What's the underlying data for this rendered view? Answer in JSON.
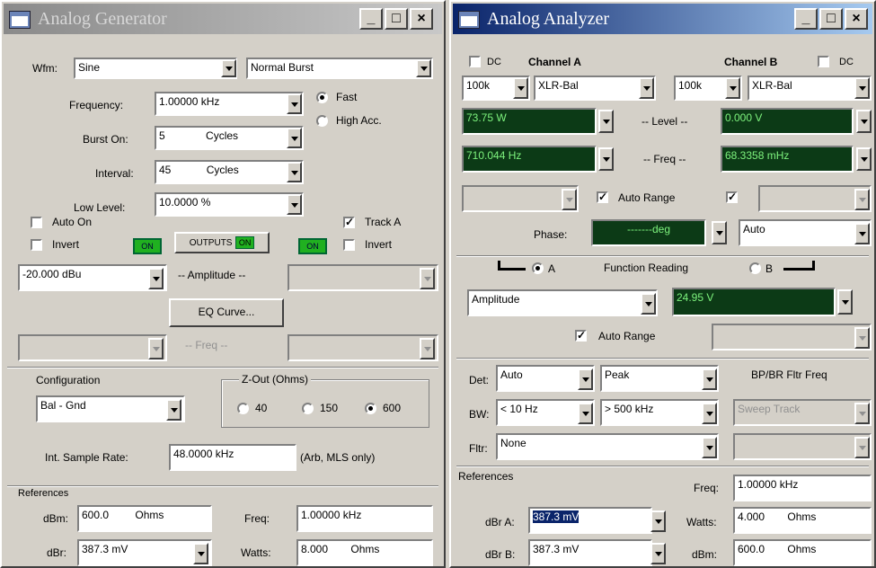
{
  "generator": {
    "title": "Analog Generator",
    "wfm_label": "Wfm:",
    "wfm_value": "Sine",
    "burst_mode": "Normal Burst",
    "frequency_label": "Frequency:",
    "frequency_value": "1.00000 kHz",
    "fast_label": "Fast",
    "high_acc_label": "High Acc.",
    "burst_on_label": "Burst On:",
    "burst_on_value": "5",
    "burst_on_unit": "Cycles",
    "interval_label": "Interval:",
    "interval_value": "45",
    "interval_unit": "Cycles",
    "low_level_label": "Low Level:",
    "low_level_value": "10.0000  %",
    "auto_on_label": "Auto On",
    "track_a_label": "Track A",
    "invert_left_label": "Invert",
    "invert_right_label": "Invert",
    "outputs_label": "OUTPUTS",
    "led_on": "ON",
    "amplitude_value": "-20.000  dBu",
    "amplitude_label": "-- Amplitude --",
    "eq_curve_button": "EQ Curve...",
    "frequency_mid_label": "-- Freq --",
    "configuration_label": "Configuration",
    "configuration_value": "Bal - Gnd",
    "zout_label": "Z-Out (Ohms)",
    "zout_40": "40",
    "zout_150": "150",
    "zout_600": "600",
    "sample_rate_label": "Int. Sample Rate:",
    "sample_rate_value": "48.0000 kHz",
    "sample_rate_note": "(Arb, MLS only)",
    "references_label": "References",
    "dbm_label": "dBm:",
    "dbm_value": "600.0",
    "dbm_unit": "Ohms",
    "freq_ref_label": "Freq:",
    "freq_ref_value": "1.00000 kHz",
    "dbr_label": "dBr:",
    "dbr_value": "387.3  mV",
    "watts_label": "Watts:",
    "watts_value": "8.000",
    "watts_unit": "Ohms"
  },
  "analyzer": {
    "title": "Analog Analyzer",
    "dc_a_label": "DC",
    "channel_a_label": "Channel A",
    "channel_b_label": "Channel B",
    "dc_b_label": "DC",
    "range_a": "100k",
    "input_a": "XLR-Bal",
    "range_b": "100k",
    "input_b": "XLR-Bal",
    "level_a": "73.75  W",
    "level_label": "-- Level --",
    "level_b": "0.000  V",
    "freq_a": "710.044 Hz",
    "freq_label": "-- Freq --",
    "freq_b": "68.3358 mHz",
    "auto_range_label": "Auto Range",
    "phase_label": "Phase:",
    "phase_value": "-------deg",
    "phase_mode": "Auto",
    "radio_a_label": "A",
    "function_reading_label": "Function Reading",
    "radio_b_label": "B",
    "function_value": "Amplitude",
    "function_reading_value": "24.95  V",
    "auto_range2_label": "Auto Range",
    "det_label": "Det:",
    "det_value": "Auto",
    "det_mode": "Peak",
    "bpbr_label": "BP/BR Fltr Freq",
    "bw_label": "BW:",
    "bw_low": "< 10 Hz",
    "bw_high": "> 500 kHz",
    "sweep_track": "Sweep Track",
    "fltr_label": "Fltr:",
    "fltr_value": "None",
    "references_label": "References",
    "freq_ref_label": "Freq:",
    "freq_ref_value": "1.00000 kHz",
    "dbr_a_label": "dBr A:",
    "dbr_a_value": "387.3  mV",
    "watts_label": "Watts:",
    "watts_value": "4.000",
    "watts_unit": "Ohms",
    "dbr_b_label": "dBr B:",
    "dbr_b_value": "387.3  mV",
    "dbm_label": "dBm:",
    "dbm_value": "600.0",
    "dbm_unit": "Ohms"
  }
}
